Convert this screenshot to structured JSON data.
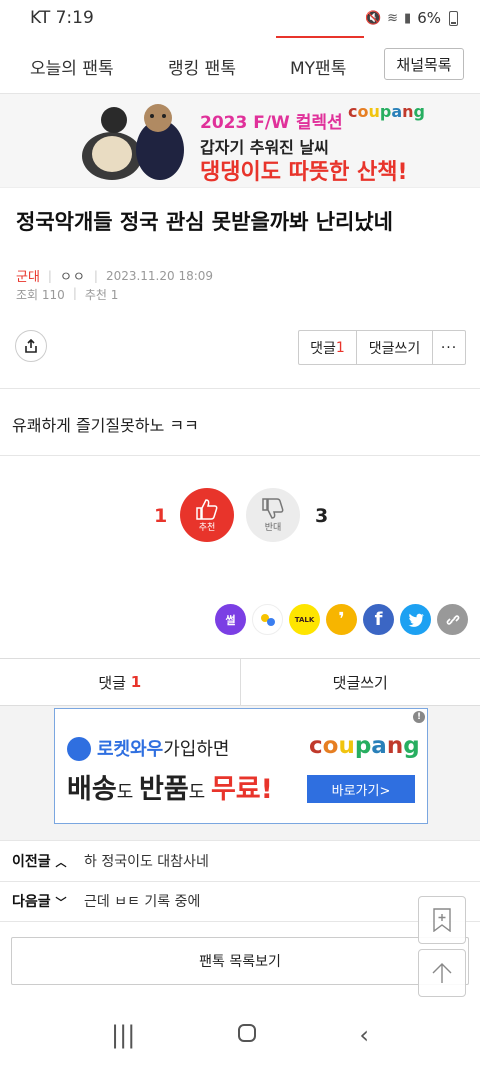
{
  "status": {
    "carrier": "KT 7:19",
    "battery": "6%"
  },
  "tabs": [
    {
      "label": "오늘의 팬톡"
    },
    {
      "label": "랭킹 팬톡"
    },
    {
      "label": "MY팬톡"
    }
  ],
  "channel_button": "채널목록",
  "ad_top": {
    "line1": "2023 F/W 컬렉션",
    "line2": "갑자기 추워진 날씨",
    "line3": "댕댕이도 따뜻한 산책!",
    "brand": "coupang"
  },
  "post": {
    "title": "정국악개들 정국 관심 못받을까봐 난리났네",
    "category": "군대",
    "author": "ㅇㅇ",
    "datetime": "2023.11.20 18:09",
    "views": "조회 110",
    "recommends": "추천 1",
    "body": "유쾌하게 즐기질못하노 ㅋㅋ"
  },
  "actions": {
    "comments_label": "댓글",
    "comments_count": "1",
    "write_comment": "댓글쓰기",
    "more": "···"
  },
  "vote": {
    "up_count": "1",
    "up_label": "추천",
    "down_count": "3",
    "down_label": "반대"
  },
  "share_buttons": [
    {
      "icon": "ssul-icon",
      "text": "썰",
      "color": "#7b3fe4"
    },
    {
      "icon": "band-icon",
      "text": "",
      "color": "#ffffff"
    },
    {
      "icon": "kakaotalk-icon",
      "text": "TALK",
      "color": "#fee500"
    },
    {
      "icon": "kakaostory-icon",
      "text": "❜",
      "color": "#f7b500"
    },
    {
      "icon": "facebook-icon",
      "text": "f",
      "color": "#3b66c4"
    },
    {
      "icon": "twitter-icon",
      "text": "🐦",
      "color": "#1da1f2"
    },
    {
      "icon": "link-icon",
      "text": "🔗",
      "color": "#999999"
    }
  ],
  "comment_bar": {
    "comments_label": "댓글",
    "comments_count": "1",
    "write_comment": "댓글쓰기"
  },
  "ad_bottom": {
    "line1_brand": "로켓와우",
    "line1_rest": "가입하면",
    "brand": "coupang",
    "w1": "배송",
    "s1": "도 ",
    "w2": "반품",
    "s2": "도 ",
    "w3": "무료!",
    "cta": "바로가기>",
    "info": "!"
  },
  "prev_post": {
    "label": "이전글",
    "title": "하 정국이도 대참사네"
  },
  "next_post": {
    "label": "다음글",
    "title": "근데 ㅂㅌ 기록 중에"
  },
  "list_button": "팬톡 목록보기",
  "colors": {
    "accent": "#e8342b",
    "link_blue": "#2f6fe0"
  }
}
